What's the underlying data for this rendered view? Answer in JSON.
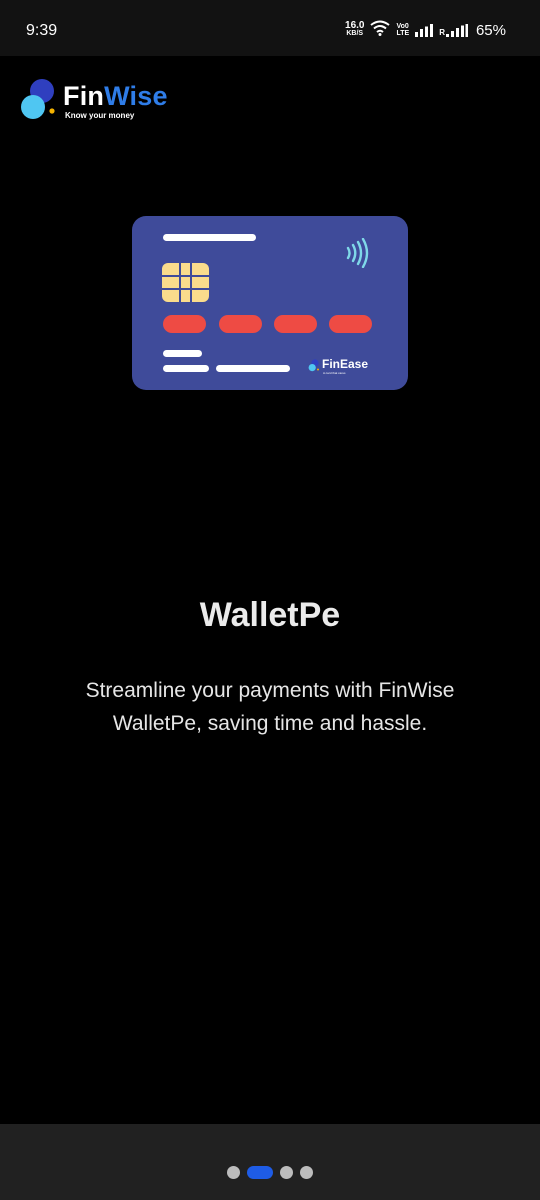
{
  "status_bar": {
    "time": "9:39",
    "net_speed_value": "16.0",
    "net_speed_unit": "KB/S",
    "volte_top": "Vo0",
    "volte_bottom": "LTE",
    "roaming_label": "R",
    "battery": "65%"
  },
  "logo": {
    "name_part1": "Fin",
    "name_part2": "Wise",
    "tagline": "Know your money"
  },
  "card": {
    "brand": "FinEase",
    "brand_tagline": "A card that cares"
  },
  "onboarding": {
    "title": "WalletPe",
    "description": "Streamline your payments with FinWise WalletPe, saving time and hassle.",
    "total_pages": 4,
    "current_page": 2
  },
  "colors": {
    "brand_blue": "#2f7de8",
    "card_bg": "#3f4b9a",
    "card_stripe_red": "#ee4b44",
    "chip_yellow": "#fadc8c",
    "active_indicator": "#1e5ce6"
  }
}
